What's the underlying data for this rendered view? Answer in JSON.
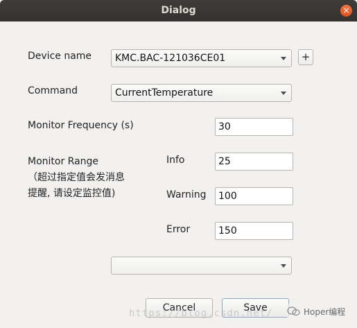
{
  "window": {
    "title": "Dialog",
    "close_glyph": "×"
  },
  "form": {
    "device_name_label": "Device name",
    "device_name_value": "KMC.BAC-121036CE01",
    "add_device_glyph": "+",
    "command_label": "Command",
    "command_value": "CurrentTemperature",
    "monitor_frequency_label": "Monitor Frequency (s)",
    "monitor_frequency_value": "30",
    "monitor_range_label": "Monitor Range",
    "monitor_range_note_line1": "（超过指定值会发消息",
    "monitor_range_note_line2": "提醒, 请设定监控值)",
    "info_label": "Info",
    "info_value": "25",
    "warning_label": "Warning",
    "warning_value": "100",
    "error_label": "Error",
    "error_value": "150",
    "extra_select_value": ""
  },
  "buttons": {
    "cancel_label": "Cancel",
    "save_label": "Save"
  },
  "watermark": {
    "url_text": "https://blog.csdn.net/",
    "badge_text": "Hoper编程"
  },
  "icons": [
    "close-icon",
    "chevron-down-icon",
    "plus-icon",
    "wechat-icon"
  ]
}
